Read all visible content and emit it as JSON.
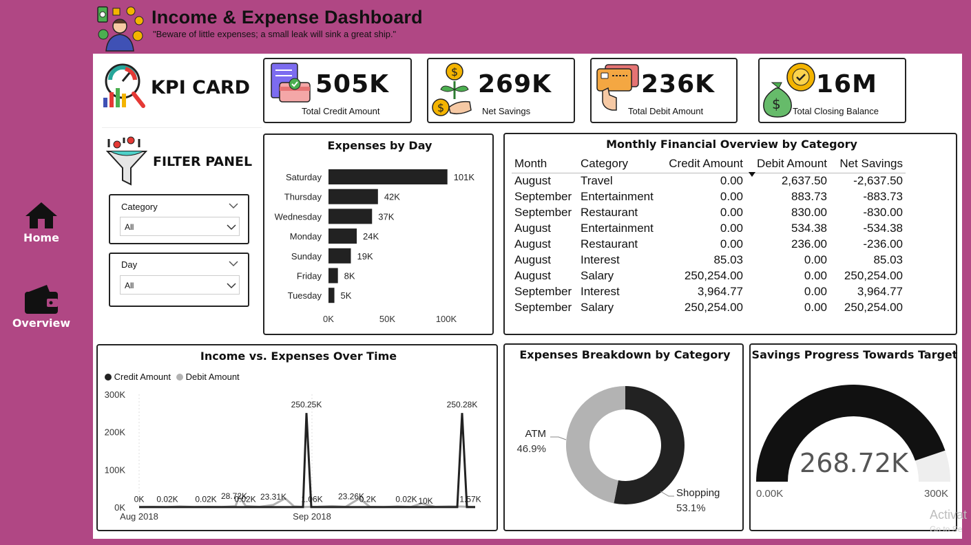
{
  "header": {
    "title": "Income & Expense Dashboard",
    "quote": "\"Beware of little expenses; a small leak will sink a great ship.\""
  },
  "nav": {
    "home_label": "Home",
    "overview_label": "Overview"
  },
  "kpi_card_label": "KPI CARD",
  "kpis": [
    {
      "value": "505K",
      "label": "Total Credit Amount",
      "icon": "credit-card-icon"
    },
    {
      "value": "269K",
      "label": "Net Savings",
      "icon": "money-plant-icon"
    },
    {
      "value": "236K",
      "label": "Total Debit Amount",
      "icon": "debit-card-icon"
    },
    {
      "value": "16M",
      "label": "Total Closing Balance",
      "icon": "money-bag-icon"
    }
  ],
  "filter_panel": {
    "title": "FILTER PANEL",
    "slicers": [
      {
        "label": "Category",
        "value": "All"
      },
      {
        "label": "Day",
        "value": "All"
      }
    ]
  },
  "expenses_by_day": {
    "title": "Expenses by Day",
    "x_ticks": [
      "0K",
      "50K",
      "100K"
    ]
  },
  "monthly_table": {
    "title": "Monthly Financial Overview by Category",
    "columns": [
      "Month",
      "Category",
      "Credit Amount",
      "Debit Amount",
      "Net Savings"
    ],
    "sorted_column": "Debit Amount",
    "rows": [
      [
        "August",
        "Travel",
        "0.00",
        "2,637.50",
        "-2,637.50"
      ],
      [
        "September",
        "Entertainment",
        "0.00",
        "883.73",
        "-883.73"
      ],
      [
        "September",
        "Restaurant",
        "0.00",
        "830.00",
        "-830.00"
      ],
      [
        "August",
        "Entertainment",
        "0.00",
        "534.38",
        "-534.38"
      ],
      [
        "August",
        "Restaurant",
        "0.00",
        "236.00",
        "-236.00"
      ],
      [
        "August",
        "Interest",
        "85.03",
        "0.00",
        "85.03"
      ],
      [
        "August",
        "Salary",
        "250,254.00",
        "0.00",
        "250,254.00"
      ],
      [
        "September",
        "Interest",
        "3,964.77",
        "0.00",
        "3,964.77"
      ],
      [
        "September",
        "Salary",
        "250,254.00",
        "0.00",
        "250,254.00"
      ]
    ]
  },
  "income_vs_expenses": {
    "title": "Income vs. Expenses Over Time",
    "legend": [
      {
        "name": "Credit Amount",
        "color": "#222222"
      },
      {
        "name": "Debit Amount",
        "color": "#b3b3b3"
      }
    ],
    "y_ticks": [
      "300K",
      "200K",
      "100K",
      "0K"
    ],
    "x_ticks": [
      "Aug 2018",
      "Sep 2018"
    ],
    "labels": [
      "0K",
      "0.02K",
      "0.02K",
      "28.72K",
      "0.02K",
      "23.31K",
      "250.25K",
      "1.06K",
      "23.26K",
      "0.2K",
      "0.02K",
      "10K",
      "250.28K",
      "1.57K"
    ]
  },
  "expenses_breakdown": {
    "title": "Expenses Breakdown by Category"
  },
  "savings_progress": {
    "title": "Savings Progress Towards Target",
    "value_label": "268.72K",
    "min_label": "0.00K",
    "max_label": "300K",
    "value": 268.72,
    "min": 0,
    "max": 300
  },
  "watermark": {
    "line1": "Activat",
    "line2": "Go to Se"
  },
  "colors": {
    "background": "#b04784",
    "dark": "#222222",
    "light": "#b3b3b3"
  },
  "chart_data": [
    {
      "type": "bar",
      "title": "Expenses by Day",
      "categories": [
        "Saturday",
        "Thursday",
        "Wednesday",
        "Monday",
        "Sunday",
        "Friday",
        "Tuesday"
      ],
      "values": [
        101,
        42,
        37,
        24,
        19,
        8,
        5
      ],
      "value_labels": [
        "101K",
        "42K",
        "37K",
        "24K",
        "19K",
        "8K",
        "5K"
      ],
      "unit": "K",
      "xlim": [
        0,
        100
      ]
    },
    {
      "type": "line",
      "title": "Income vs. Expenses Over Time",
      "x": [
        "Aug 2018",
        "Sep 2018"
      ],
      "series": [
        {
          "name": "Credit Amount",
          "peaks": [
            {
              "x": "Aug 2018 (late)",
              "value": 250.25
            },
            {
              "x": "Sep 2018 (late)",
              "value": 250.28
            }
          ]
        },
        {
          "name": "Debit Amount",
          "peaks": [
            {
              "value": 28.72
            },
            {
              "value": 23.31
            },
            {
              "value": 23.26
            },
            {
              "value": 10
            }
          ]
        }
      ],
      "ylim": [
        0,
        300
      ],
      "unit": "K"
    },
    {
      "type": "pie",
      "title": "Expenses Breakdown by Category",
      "slices": [
        {
          "name": "Shopping",
          "value": 53.1,
          "label": "53.1%",
          "color": "#222222"
        },
        {
          "name": "ATM",
          "value": 46.9,
          "label": "46.9%",
          "color": "#b3b3b3"
        }
      ]
    }
  ]
}
